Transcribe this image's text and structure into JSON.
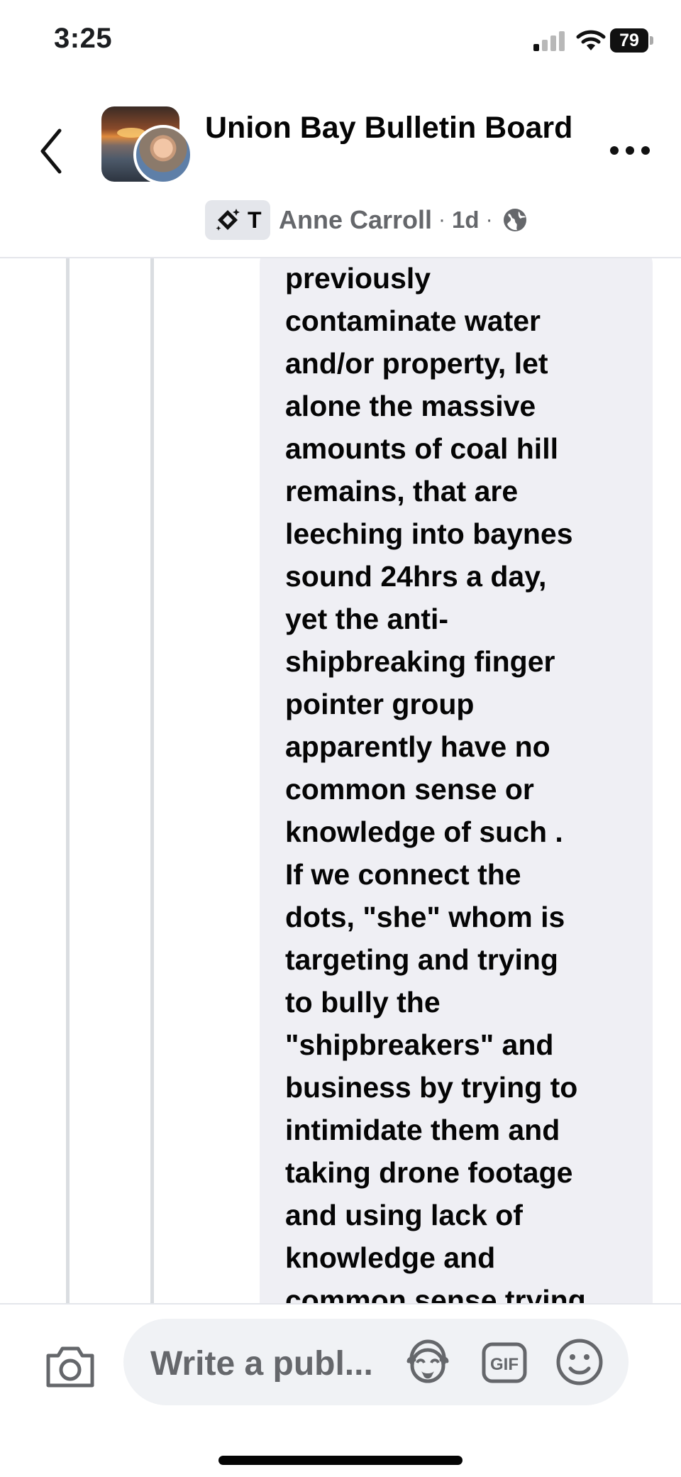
{
  "status_bar": {
    "time": "3:25",
    "battery": "79"
  },
  "header": {
    "group_name": "Union Bay Bulletin Board",
    "badge_label": "T",
    "author": "Anne Carroll",
    "separator": "·",
    "age": "1d"
  },
  "comment": {
    "text": "previously\ncontaminate water\nand/or property, let\nalone the massive\namounts of coal hill\nremains, that are\nleeching into baynes\nsound 24hrs a day,\nyet the anti-\nshipbreaking finger\npointer group\napparently have no\ncommon sense or\nknowledge of such .\nIf we connect the\ndots, \"she\" whom is\ntargeting and trying\nto bully the\n\"shipbreakers\" and\nbusiness by trying to\nintimidate them and\ntaking drone footage\nand using lack of\nknowledge and\ncommon sense trying"
  },
  "composer": {
    "placeholder": "Write a publ..."
  },
  "icons": {
    "back": "back-chevron-icon",
    "more": "more-dots-icon",
    "badge": "sparkle-diamond-icon",
    "globe": "globe-icon",
    "camera": "camera-icon",
    "avatar_sticker": "avatar-sticker-icon",
    "gif": "gif-icon",
    "emoji": "emoji-icon"
  },
  "colors": {
    "bubble": "#efeff4",
    "secondary_text": "#65676b",
    "primary_text": "#050505"
  }
}
